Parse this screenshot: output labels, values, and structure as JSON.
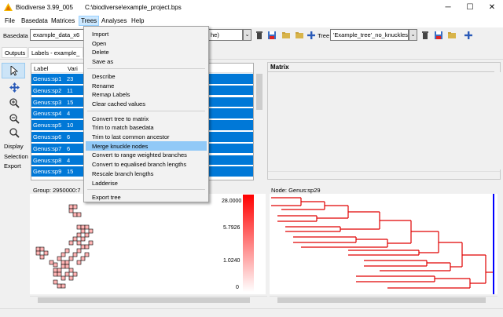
{
  "window": {
    "title": "Biodiverse 3.99_005",
    "path": "C:\\biodiverse\\example_project.bps",
    "minimize": "─",
    "maximize": "☐",
    "close": "✕"
  },
  "menubar": [
    "File",
    "Basedata",
    "Matrices",
    "Trees",
    "Analyses",
    "Help"
  ],
  "toolbar": {
    "basedata_label": "Basedata",
    "basedata_value": "example_data_x6",
    "matrix_value_tail": "he)",
    "tree_label": "Tree",
    "tree_value": "'Example_tree'_no_knuckles"
  },
  "side": {
    "outputs_tab": "Outputs",
    "tools": [
      "Display",
      "Selection",
      "Export"
    ]
  },
  "labels_tab": "Labels - example_",
  "label_list": {
    "headers": [
      "Label",
      "Vari"
    ],
    "rows": [
      [
        "Genus:sp1",
        "23"
      ],
      [
        "Genus:sp2",
        "11"
      ],
      [
        "Genus:sp3",
        "15"
      ],
      [
        "Genus:sp4",
        "4"
      ],
      [
        "Genus:sp5",
        "10"
      ],
      [
        "Genus:sp6",
        "6"
      ],
      [
        "Genus:sp7",
        "6"
      ],
      [
        "Genus:sp8",
        "4"
      ],
      [
        "Genus:sp9",
        "15"
      ]
    ]
  },
  "trees_menu": {
    "items": [
      {
        "label": "Import",
        "highlighted": false
      },
      {
        "label": "Open",
        "highlighted": false
      },
      {
        "label": "Delete",
        "highlighted": false
      },
      {
        "label": "Save as",
        "highlighted": false
      },
      {
        "sep": true
      },
      {
        "label": "Describe",
        "highlighted": false
      },
      {
        "label": "Rename",
        "highlighted": false
      },
      {
        "label": "Remap Labels",
        "highlighted": false
      },
      {
        "label": "Clear cached values",
        "highlighted": false
      },
      {
        "sep": true
      },
      {
        "label": "Convert tree to matrix",
        "highlighted": false
      },
      {
        "label": "Trim to match basedata",
        "highlighted": false
      },
      {
        "label": "Trim to last common ancestor",
        "highlighted": false
      },
      {
        "label": "Merge knuckle nodes",
        "highlighted": true
      },
      {
        "label": "Convert to range weighted branches",
        "highlighted": false
      },
      {
        "label": "Convert to equalised branch lengths",
        "highlighted": false
      },
      {
        "label": "Rescale branch lengths",
        "highlighted": false
      },
      {
        "label": "Ladderise",
        "highlighted": false
      },
      {
        "sep": true
      },
      {
        "label": "Export tree",
        "highlighted": false
      }
    ]
  },
  "matrix": {
    "title": "Matrix"
  },
  "group_label": "Group: 2950000:7",
  "legend": {
    "ticks": [
      "28.0000",
      "5.7926",
      "1.0240",
      "0"
    ]
  },
  "tree_panel": {
    "node_label": "Node: Genus:sp29"
  },
  "colors": {
    "selection": "#0078d7",
    "menu_highlight": "#91c9f7",
    "branch_red": "#e00000",
    "cursor_blue": "#0000ff"
  }
}
